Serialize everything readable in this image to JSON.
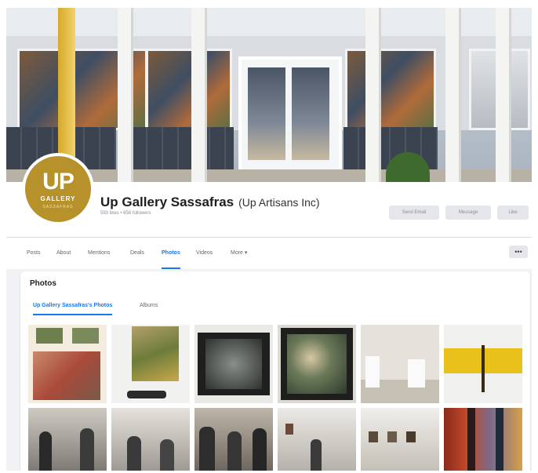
{
  "page": {
    "name": "Up Gallery Sassafras",
    "alt_name": "(Up Artisans Inc)",
    "meta": "593 likes • 658 followers",
    "logo_text": "UP",
    "logo_sub": "GALLERY",
    "logo_sub2": "SASSAFRAS"
  },
  "header_buttons": [
    "Send Email",
    "Message",
    "Like"
  ],
  "nav": {
    "tabs": [
      "Posts",
      "About",
      "Mentions",
      "Deals",
      "Photos",
      "Videos",
      "More ▾"
    ],
    "active": "Photos",
    "more_icon": "•••"
  },
  "photos": {
    "title": "Photos",
    "tabs": [
      "Up Gallery Sassafras's Photos",
      "Albums"
    ],
    "active_tab": "Up Gallery Sassafras's Photos",
    "thumbnails": [
      {
        "desc": "artwork-paintings-wall"
      },
      {
        "desc": "artwork-bird-painting"
      },
      {
        "desc": "framed-foggy-landscape"
      },
      {
        "desc": "framed-flower-painting"
      },
      {
        "desc": "gallery-interior"
      },
      {
        "desc": "yellow-wall-plant-sculpture"
      },
      {
        "desc": "crowd-opening-night"
      },
      {
        "desc": "crowd-gallery-hall"
      },
      {
        "desc": "crowd-busy-room"
      },
      {
        "desc": "gallery-long-wall"
      },
      {
        "desc": "gallery-framed-row"
      },
      {
        "desc": "colorful-hanging-art"
      }
    ]
  },
  "colors": {
    "accent": "#1877f2",
    "logo_gold": "#b79129"
  }
}
